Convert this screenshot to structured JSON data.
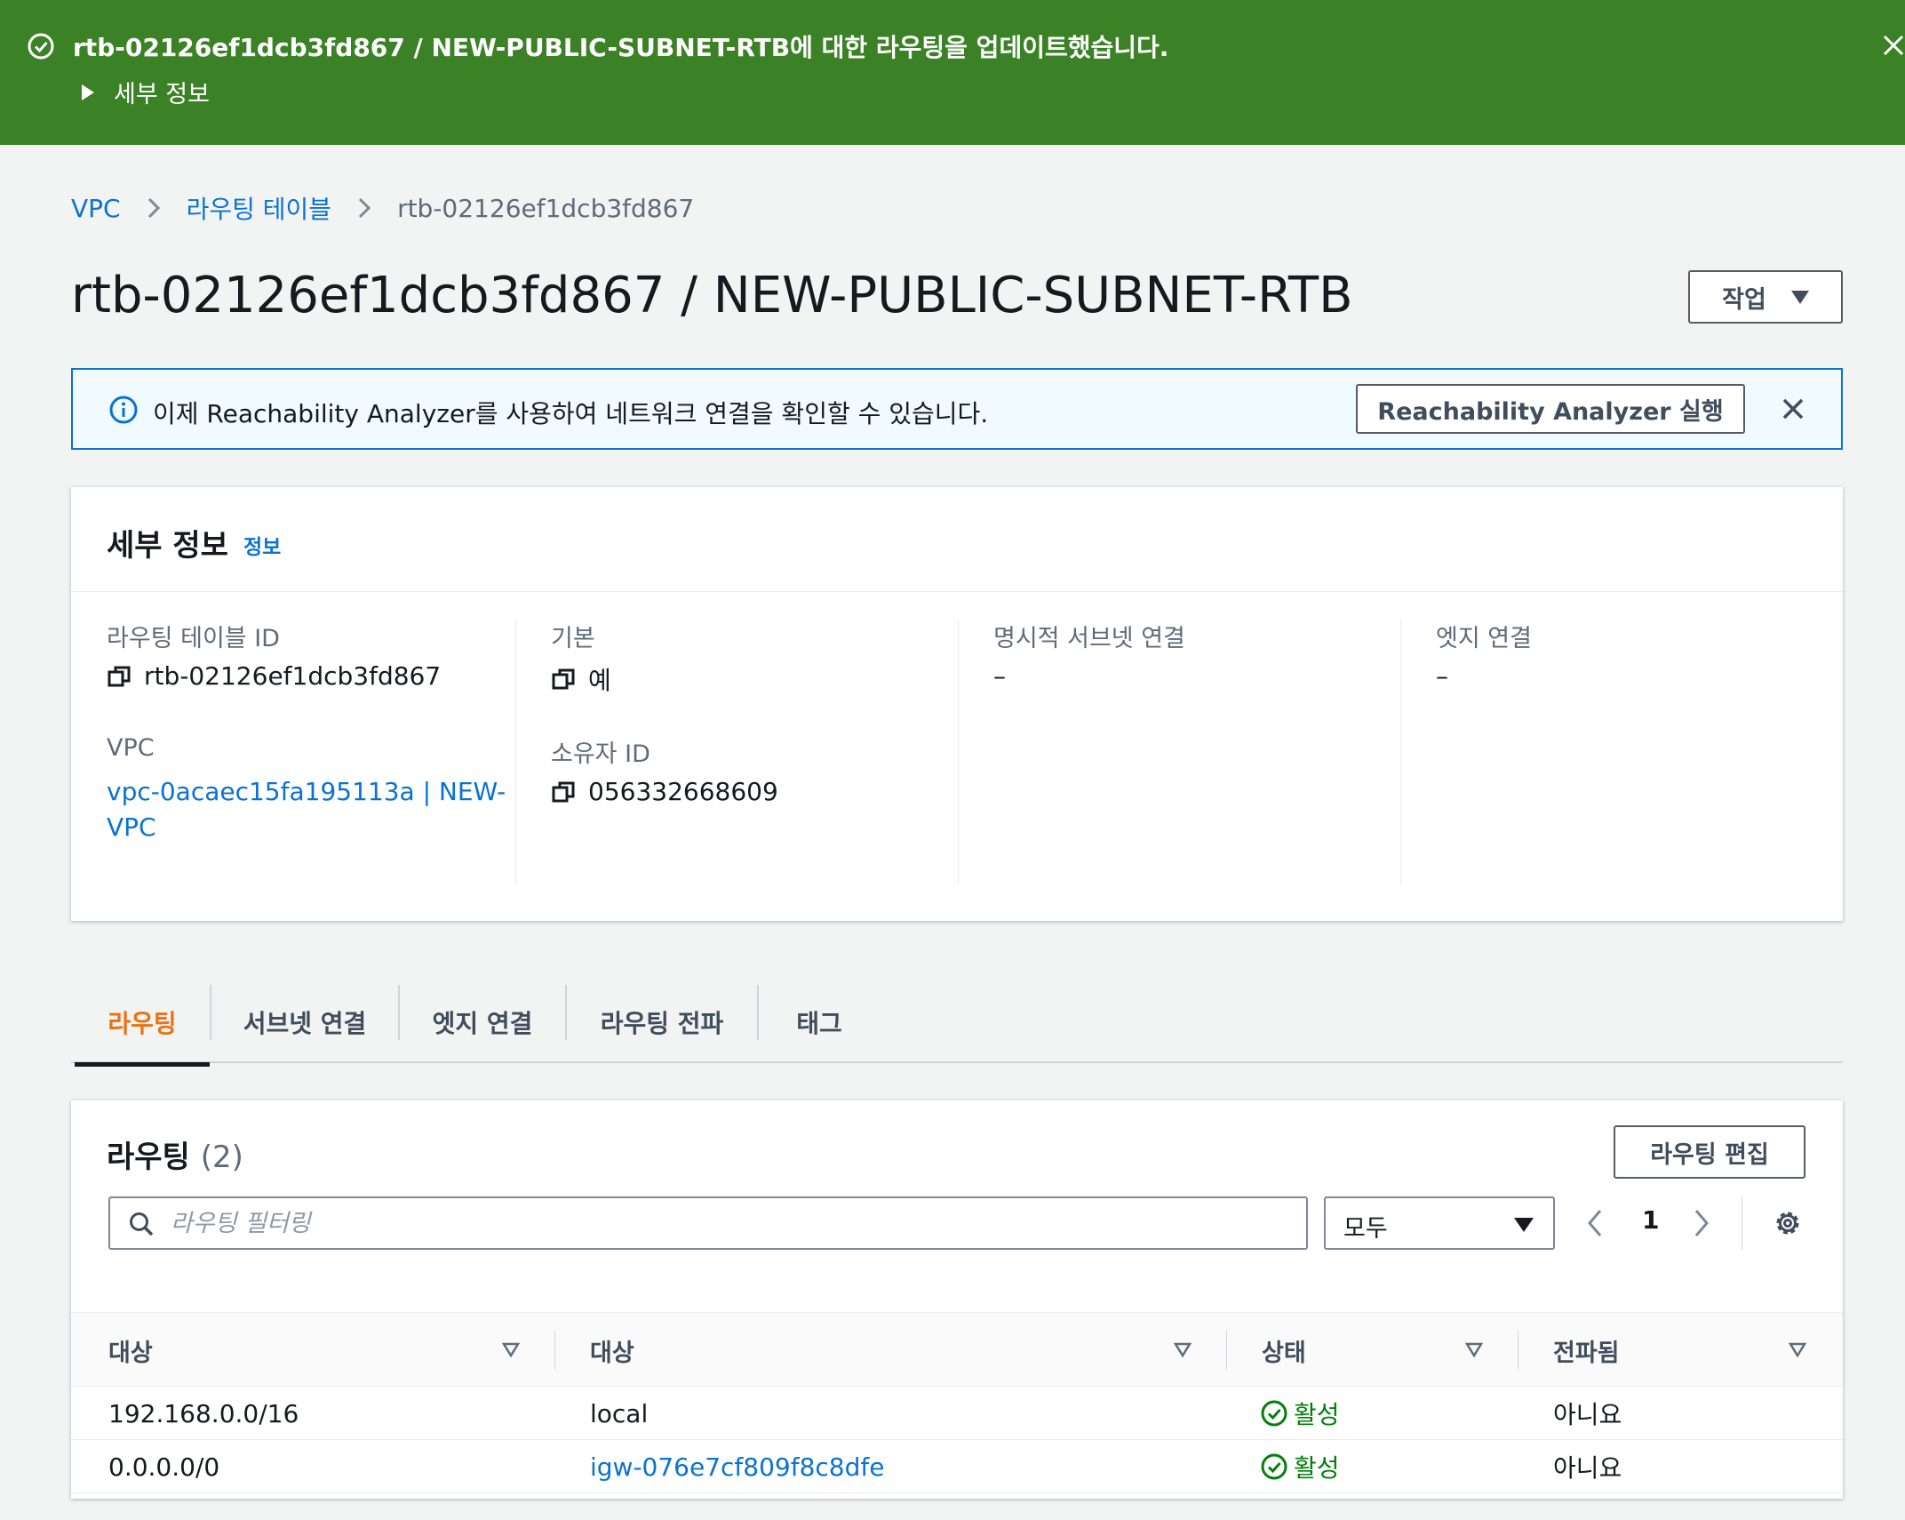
{
  "flash": {
    "message": "rtb-02126ef1dcb3fd867 / NEW-PUBLIC-SUBNET-RTB에 대한 라우팅을 업데이트했습니다.",
    "details_label": "세부 정보"
  },
  "breadcrumb": {
    "items": [
      "VPC",
      "라우팅 테이블",
      "rtb-02126ef1dcb3fd867"
    ]
  },
  "header": {
    "title": "rtb-02126ef1dcb3fd867 / NEW-PUBLIC-SUBNET-RTB",
    "actions_label": "작업"
  },
  "info_alert": {
    "text": "이제 Reachability Analyzer를 사용하여 네트워크 연결을 확인할 수 있습니다.",
    "button_label": "Reachability Analyzer 실행"
  },
  "details": {
    "title": "세부 정보",
    "info_link": "정보",
    "fields": {
      "route_table_id_label": "라우팅 테이블 ID",
      "route_table_id": "rtb-02126ef1dcb3fd867",
      "vpc_label": "VPC",
      "vpc_line1": "vpc-0acaec15fa195113a | NEW-",
      "vpc_line2": "VPC",
      "main_label": "기본",
      "main_value": "예",
      "owner_label": "소유자 ID",
      "owner_value": "056332668609",
      "explicit_subnet_label": "명시적 서브넷 연결",
      "explicit_subnet_value": "–",
      "edge_label": "엣지 연결",
      "edge_value": "–"
    }
  },
  "tabs": [
    "라우팅",
    "서브넷 연결",
    "엣지 연결",
    "라우팅 전파",
    "태그"
  ],
  "routes": {
    "title": "라우팅",
    "count": "(2)",
    "edit_label": "라우팅 편집",
    "filter_placeholder": "라우팅 필터링",
    "select_value": "모두",
    "page": "1",
    "columns": [
      "대상",
      "대상",
      "상태",
      "전파됨"
    ],
    "rows": [
      {
        "destination": "192.168.0.0/16",
        "target": "local",
        "target_link": false,
        "status": "활성",
        "propagated": "아니요"
      },
      {
        "destination": "0.0.0.0/0",
        "target": "igw-076e7cf809f8c8dfe",
        "target_link": true,
        "status": "활성",
        "propagated": "아니요"
      }
    ]
  },
  "colors": {
    "success": "#3b8226",
    "link": "#0972d3",
    "active_tab": "#ec7211",
    "status_ok": "#037f0c"
  }
}
